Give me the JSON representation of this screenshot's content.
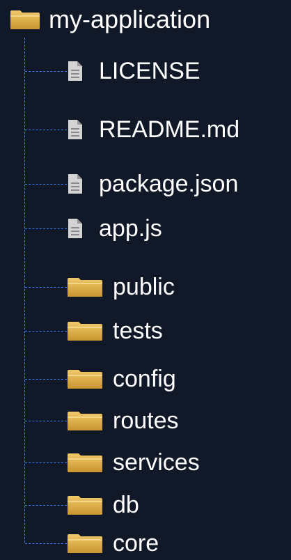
{
  "root": {
    "name": "my-application",
    "icon": "folder-icon",
    "folder_color": "#dcae52"
  },
  "items": [
    {
      "name": "LICENSE",
      "type": "file",
      "icon": "file-icon"
    },
    {
      "name": "README.md",
      "type": "file",
      "icon": "file-icon"
    },
    {
      "name": "package.json",
      "type": "file",
      "icon": "file-icon"
    },
    {
      "name": "app.js",
      "type": "file",
      "icon": "file-icon"
    },
    {
      "name": "public",
      "type": "folder",
      "icon": "folder-icon"
    },
    {
      "name": "tests",
      "type": "folder",
      "icon": "folder-icon"
    },
    {
      "name": "config",
      "type": "folder",
      "icon": "folder-icon"
    },
    {
      "name": "routes",
      "type": "folder",
      "icon": "folder-icon"
    },
    {
      "name": "services",
      "type": "folder",
      "icon": "folder-icon"
    },
    {
      "name": "db",
      "type": "folder",
      "icon": "folder-icon"
    },
    {
      "name": "core",
      "type": "folder",
      "icon": "folder-icon"
    }
  ],
  "colors": {
    "background": "#111827",
    "connector": "#3b82f6",
    "text": "#ffffff",
    "file_icon": "#d4d4d4"
  }
}
